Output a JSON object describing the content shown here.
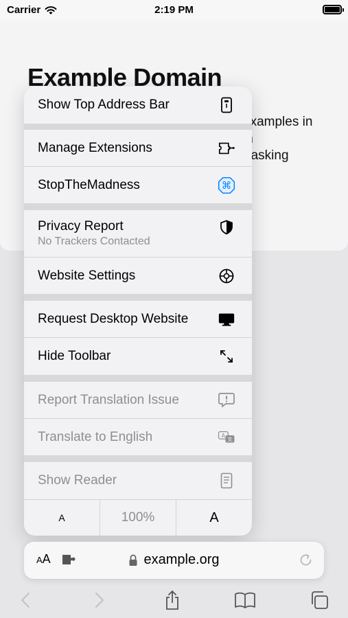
{
  "status_bar": {
    "carrier": "Carrier",
    "time": "2:19 PM"
  },
  "page": {
    "title": "Example Domain",
    "body_fragment": "examples in\nin\nr asking"
  },
  "menu": {
    "items": [
      {
        "label": "Show Top Address Bar",
        "icon": "top-address-bar-icon"
      },
      {
        "label": "Manage Extensions",
        "icon": "extensions-icon"
      },
      {
        "label": "StopTheMadness",
        "icon": "command-icon"
      },
      {
        "label": "Privacy Report",
        "sublabel": "No Trackers Contacted",
        "icon": "shield-icon"
      },
      {
        "label": "Website Settings",
        "icon": "gear-icon"
      },
      {
        "label": "Request Desktop Website",
        "icon": "desktop-icon"
      },
      {
        "label": "Hide Toolbar",
        "icon": "expand-arrows-icon"
      },
      {
        "label": "Report Translation Issue",
        "icon": "report-bubble-icon",
        "disabled": true
      },
      {
        "label": "Translate to English",
        "icon": "translate-icon",
        "disabled": true
      },
      {
        "label": "Show Reader",
        "icon": "reader-icon",
        "disabled": true
      }
    ],
    "font_size": {
      "smaller": "A",
      "zoom": "100%",
      "larger": "A"
    }
  },
  "address_bar": {
    "aa_large": "A",
    "aa_small": "A",
    "url": "example.org"
  },
  "colors": {
    "accent": "#0a84ff",
    "disabled": "#8e8e93",
    "menu_bg": "#f2f2f4"
  }
}
